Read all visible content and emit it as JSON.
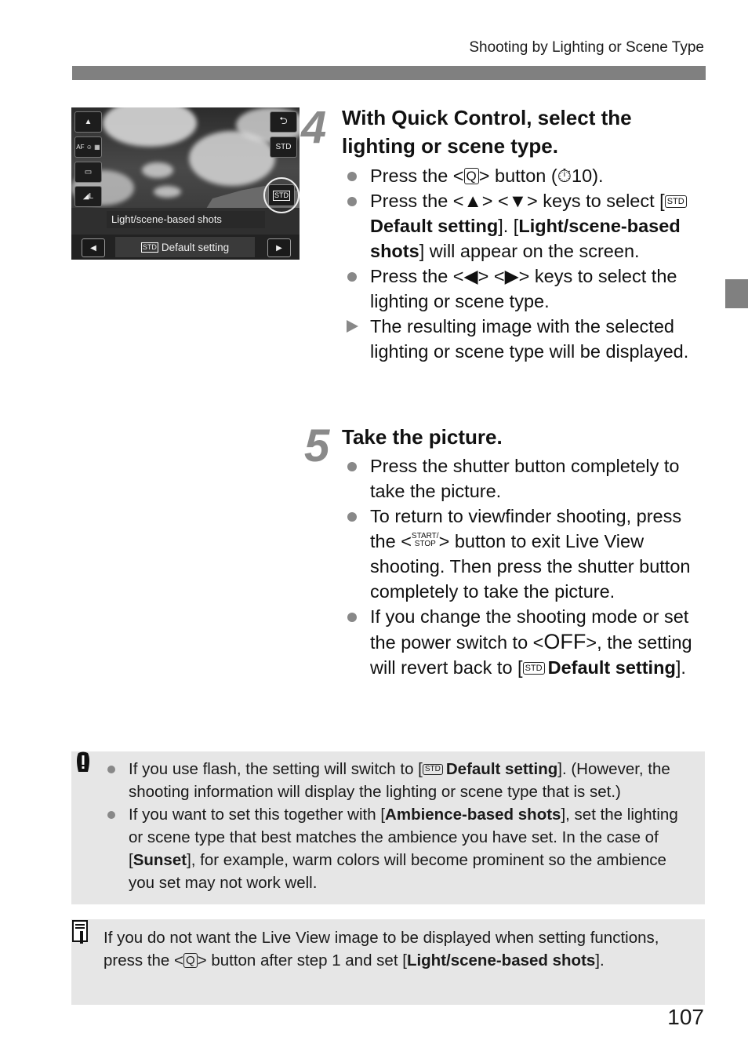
{
  "header": {
    "running_title": "Shooting by Lighting or Scene Type"
  },
  "camera_screen": {
    "left_buttons": [
      {
        "icon": "ambience-icon",
        "label": "▲"
      },
      {
        "icon": "af-mode-icon",
        "label": "AF ☺ ▦"
      },
      {
        "icon": "drive-mode-icon",
        "label": "▭"
      },
      {
        "icon": "image-quality-icon",
        "label": "◢L"
      }
    ],
    "right_buttons": [
      {
        "icon": "return-icon",
        "label": "⮌"
      },
      {
        "icon": "std-ambience-icon",
        "label": "STD"
      }
    ],
    "selected_icon_label": "STD",
    "setting_label": "Light/scene-based shots",
    "current_value_icon": "STD",
    "current_value": "Default setting",
    "prev_arrow": "◀",
    "next_arrow": "▶"
  },
  "step4": {
    "number": "4",
    "title": "With Quick Control, select the lighting or scene type.",
    "bullets": {
      "b1_pre": "Press the <",
      "b1_key": "Q",
      "b1_post": "> button (",
      "b1_timer": "⏱10",
      "b1_end": ").",
      "b2_pre": "Press the <▲> <▼> keys to select [",
      "b2_icon": "STD",
      "b2_bold1": "Default setting",
      "b2_mid": "]. [",
      "b2_bold2": "Light/scene-based shots",
      "b2_post": "] will appear on the screen.",
      "b3": "Press the <◀> <▶> keys to select the lighting or scene type.",
      "b4": "The resulting image with the selected lighting or scene type will be displayed."
    }
  },
  "step5": {
    "number": "5",
    "title": "Take the picture.",
    "bullets": {
      "b1": "Press the shutter button completely to take the picture.",
      "b2_pre": "To return to viewfinder shooting, press the <",
      "b2_key_top": "START/",
      "b2_key_bottom": "STOP",
      "b2_post": "> button to exit Live View shooting. Then press the shutter button completely to take the picture.",
      "b3_pre": "If you change the shooting mode or set the power switch to <",
      "b3_off": "OFF",
      "b3_mid": ">, the setting will revert back to [",
      "b3_icon": "STD",
      "b3_bold": "Default setting",
      "b3_end": "]."
    }
  },
  "caution": {
    "icon": "caution-icon",
    "b1_pre": "If you use flash, the setting will switch to [",
    "b1_icon": "STD",
    "b1_bold": "Default setting",
    "b1_post": "]. (However, the shooting information will display the lighting or scene type that is set.)",
    "b2_pre": "If you want to set this together with [",
    "b2_bold1": "Ambience-based shots",
    "b2_mid": "], set the lighting or scene type that best matches the ambience you have set. In the case of [",
    "b2_bold2": "Sunset",
    "b2_post": "], for example, warm colors will become prominent so the ambience you set may not work well."
  },
  "memo": {
    "icon": "memo-icon",
    "pre": "If you do not want the Live View image to be displayed when setting functions, press the <",
    "key": "Q",
    "mid": "> button after step 1 and set [",
    "bold": "Light/scene-based shots",
    "end": "]."
  },
  "footer": {
    "page_number": "107"
  }
}
